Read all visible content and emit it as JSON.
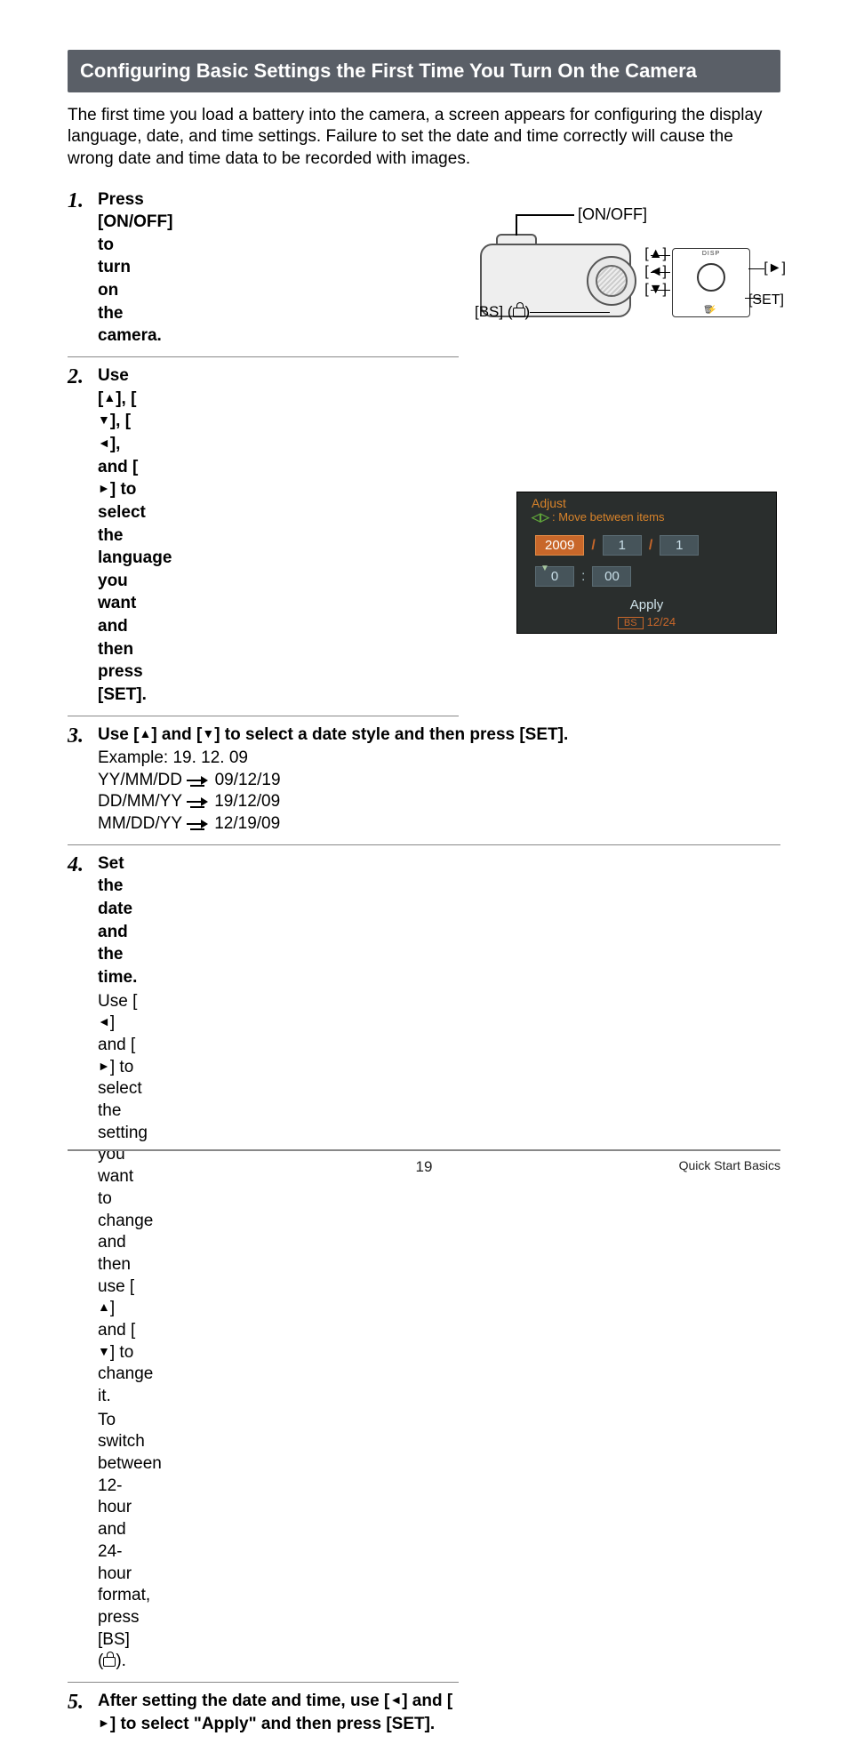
{
  "section_title": "Configuring Basic Settings the First Time You Turn On the Camera",
  "intro": "The first time you load a battery into the camera, a screen appears for configuring the display language, date, and time settings. Failure to set the date and time correctly will cause the wrong date and time data to be recorded with images.",
  "steps": {
    "s1": {
      "num": "1.",
      "title": "Press [ON/OFF] to turn on the camera."
    },
    "s2": {
      "num": "2.",
      "title_pre": "Use [",
      "title_mid1": "], [",
      "title_mid2": "], [",
      "title_mid3": "], and [",
      "title_post": "] to select the language you want and then press [SET]."
    },
    "s3": {
      "num": "3.",
      "title_pre": "Use [",
      "title_mid": "] and [",
      "title_post": "] to select a date style and then press [SET].",
      "example_label": "Example: 19. 12. 09",
      "fmt1_label": "YY/MM/DD",
      "fmt1_val": "09/12/19",
      "fmt2_label": "DD/MM/YY",
      "fmt2_val": "19/12/09",
      "fmt3_label": "MM/DD/YY",
      "fmt3_val": "12/19/09"
    },
    "s4": {
      "num": "4.",
      "title": "Set the date and the time.",
      "body_pre": "Use [",
      "body_mid1": "] and [",
      "body_mid2": "] to select the setting you want to change and then use [",
      "body_mid3": "] and [",
      "body_mid4": "] to change it.",
      "body2": "To switch between 12-hour and 24-hour format, press [BS] (",
      "body2_end": ")."
    },
    "s5": {
      "num": "5.",
      "title_pre": "After setting the date and time, use [",
      "title_mid": "] and [",
      "title_post": "] to select \"Apply\" and then press [SET]."
    }
  },
  "camera_labels": {
    "onoff": "[ON/OFF]",
    "up": "[▲]",
    "down": "[▼]",
    "left": "[◄]",
    "right": "[►]",
    "set": "[SET]",
    "bs": "[BS] (",
    "bs_end": ")",
    "disp": "DISP"
  },
  "lcd": {
    "adjust": "Adjust",
    "move": ": Move between items",
    "year": "2009",
    "month": "1",
    "day": "1",
    "hour": "0",
    "minute": "00",
    "apply": "Apply",
    "bs": "BS",
    "fmt": "12/24"
  },
  "footer": {
    "page": "19",
    "section": "Quick Start Basics"
  }
}
